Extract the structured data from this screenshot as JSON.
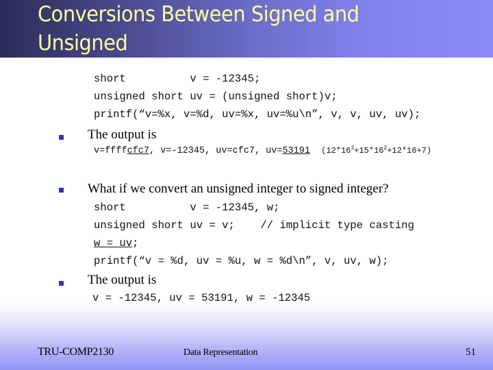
{
  "slide": {
    "title_lines": [
      "Conversions Between Signed and",
      "Unsigned"
    ],
    "code_block_1": [
      "short          v = -12345;",
      "unsigned short uv = (unsigned short)v;",
      "printf(“v=%x, v=%d, uv=%x, uv=%u\\n”, v, v, uv, uv);"
    ],
    "bullet_1": "The output is",
    "output_1": {
      "prefix": "v=ffff",
      "underlined_hex": "cfc7",
      "middle": ", v=-12345, uv=cfc7, uv=",
      "underlined_dec": "53191",
      "formula_open": "(12*16",
      "exp1": "3",
      "formula_mid1": "+15*16",
      "exp2": "2",
      "formula_end": "+12*16+7)"
    },
    "bullet_2": "What if we convert an unsigned integer to signed integer?",
    "code_block_2": [
      "short          v = -12345, w;",
      "unsigned short uv = v;    // implicit type casting"
    ],
    "code_block_2_underlined": "w = uv",
    "code_block_2_underlined_suffix": ";",
    "code_block_2_printf": "printf(“v = %d, uv = %u, w = %d\\n”, v, uv, w);",
    "bullet_3": "The output is",
    "output_2": "v = -12345, uv = 53191, w = -12345"
  },
  "footer": {
    "course": "TRU-COMP2130",
    "topic": "Data Representation",
    "page_number": "51"
  },
  "colors": {
    "title_text": "#ffff99",
    "bullet": "#3333bb"
  }
}
